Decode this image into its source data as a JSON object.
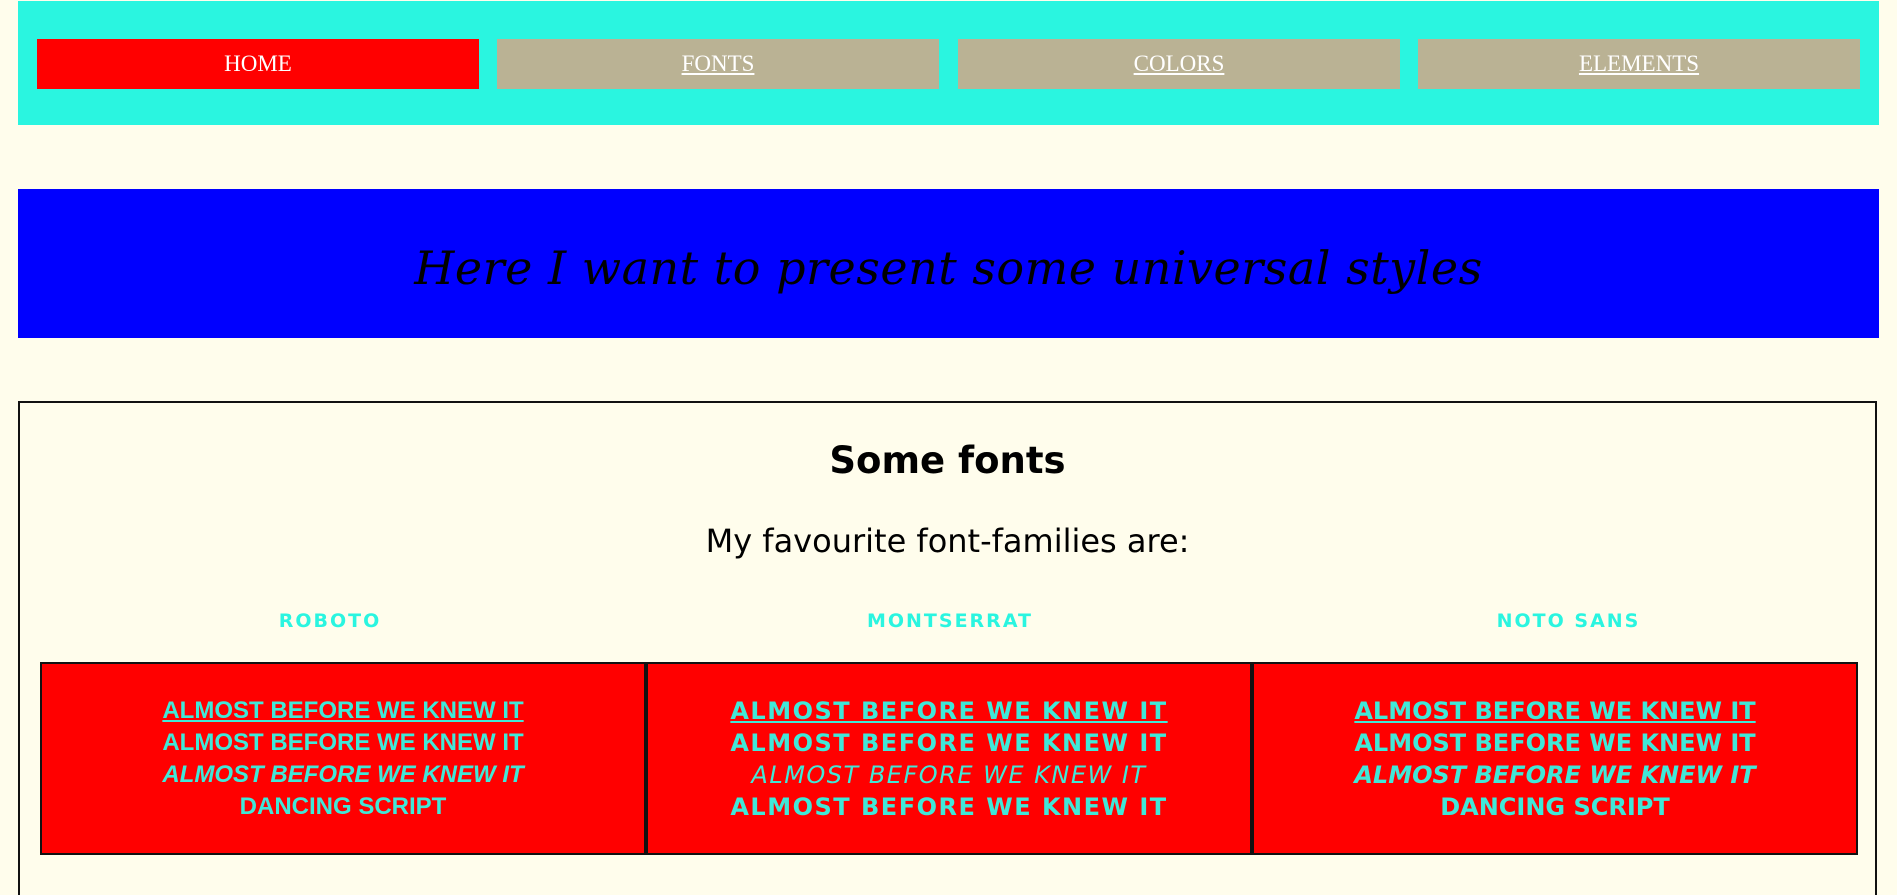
{
  "nav": {
    "items": [
      {
        "label": "HOME",
        "active": true
      },
      {
        "label": "FONTS",
        "active": false
      },
      {
        "label": "COLORS",
        "active": false
      },
      {
        "label": "ELEMENTS",
        "active": false
      }
    ]
  },
  "hero": {
    "text": "Here I want to present some universal styles"
  },
  "fonts_section": {
    "title": "Some fonts",
    "subtitle": "My favourite font-families are:",
    "columns": [
      {
        "label": "ROBOTO",
        "lines": [
          "ALMOST BEFORE WE KNEW IT",
          "ALMOST BEFORE WE KNEW IT",
          "ALMOST BEFORE WE KNEW IT",
          "DANCING SCRIPT"
        ]
      },
      {
        "label": "MONTSERRAT",
        "lines": [
          "ALMOST BEFORE WE KNEW IT",
          "ALMOST BEFORE WE KNEW IT",
          "ALMOST BEFORE WE KNEW IT",
          "ALMOST BEFORE WE KNEW IT"
        ]
      },
      {
        "label": "NOTO SANS",
        "lines": [
          "ALMOST BEFORE WE KNEW IT",
          "ALMOST BEFORE WE KNEW IT",
          "ALMOST BEFORE WE KNEW IT",
          "DANCING SCRIPT"
        ]
      }
    ]
  },
  "colors": {
    "nav_bg": "#2af5e0",
    "nav_active": "#ff0000",
    "nav_inactive": "#bab294",
    "hero_bg": "#0000ff",
    "page_bg": "#fffdec",
    "box_bg": "#ff0000",
    "accent_text": "#40e8d8"
  }
}
